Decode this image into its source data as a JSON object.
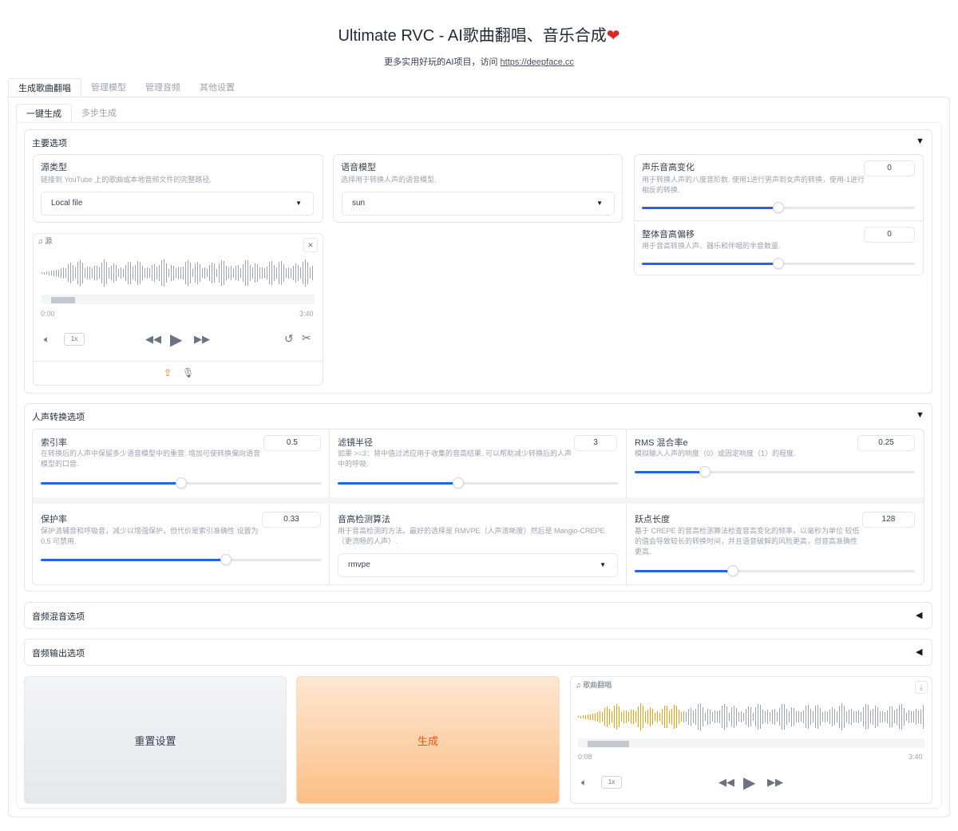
{
  "header": {
    "title": "Ultimate RVC - AI歌曲翻唱、音乐合成",
    "heart": "❤",
    "subtitle_prefix": "更多实用好玩的AI项目，访问 ",
    "subtitle_link": "https://deepface.cc"
  },
  "tabs": [
    "生成歌曲翻唱",
    "管理模型",
    "管理音频",
    "其他设置"
  ],
  "subtabs": [
    "一键生成",
    "多步生成"
  ],
  "main_options": {
    "title": "主要选项",
    "arrow": "▼",
    "source_type": {
      "label": "源类型",
      "info": "链接到 YouTube 上的歌曲或本地音频文件的完整路径.",
      "value": "Local file"
    },
    "voice_model": {
      "label": "语音模型",
      "info": "选择用于转换人声的语音模型.",
      "value": "sun"
    },
    "pitch_change": {
      "label": "声乐音高变化",
      "info": "用于转换人声的八度音阶数. 使用1进行男声到女声的转换，使用-1进行相反的转换.",
      "value": "0",
      "fraction": 0.5
    },
    "overall_pitch": {
      "label": "整体音高偏移",
      "info": "用于音高转换人声、器乐和伴唱的半音数量.",
      "value": "0",
      "fraction": 0.5
    },
    "audio": {
      "label": "源",
      "start": "0:00",
      "end": "3:40",
      "speed": "1x"
    }
  },
  "vocal_options": {
    "title": "人声转换选项",
    "arrow": "▼",
    "index_rate": {
      "label": "索引率",
      "info": "在转换后的人声中保留多少语音模型中的重音. 增加可使转换偏向语音模型的口音.",
      "value": "0.5",
      "fraction": 0.5
    },
    "filter_radius": {
      "label": "滤镜半径",
      "info": "如果 >=3：将中值过滤应用于收集的音高结果. 可以帮助减少转换后的人声中的呼吸.",
      "value": "3",
      "fraction": 0.43
    },
    "rms_mix": {
      "label": "RMS 混合率e",
      "info": "模拟输入人声的响度（0）或固定响度（1）的程度.",
      "value": "0.25",
      "fraction": 0.25
    },
    "protect": {
      "label": "保护率",
      "info": "保护清辅音和呼吸音，减少以增强保护，但代价是索引准确性 设置为 0.5 可禁用.",
      "value": "0.33",
      "fraction": 0.66
    },
    "pitch_algo": {
      "label": "音高检测算法",
      "info": "用于音高检测的方法。最好的选择是 RMVPE（人声清晰度）然后是 Mangio-CREPE（更流畅的人声）.",
      "value": "rmvpe"
    },
    "hop_length": {
      "label": "跃点长度",
      "info": "基于 CREPE 的音高检测算法检查音高变化的频率，以毫秒为单位 较低的值会导致较长的转换时间，并且语音破解的风险更高，但音高准确性更高.",
      "value": "128",
      "fraction": 0.35
    }
  },
  "mix_options": {
    "title": "音频混音选项",
    "arrow": "◀"
  },
  "output_options": {
    "title": "音频输出选项",
    "arrow": "◀"
  },
  "actions": {
    "reset": "重置设置",
    "generate": "生成"
  },
  "output_audio": {
    "label": "歌曲翻唱",
    "start": "0:08",
    "end": "3:40",
    "speed": "1x",
    "played_fraction": 0.3
  },
  "colors": {
    "accent": "#2563eb",
    "generate_text": "#ea580c",
    "played_wave": "#f59e0b"
  }
}
